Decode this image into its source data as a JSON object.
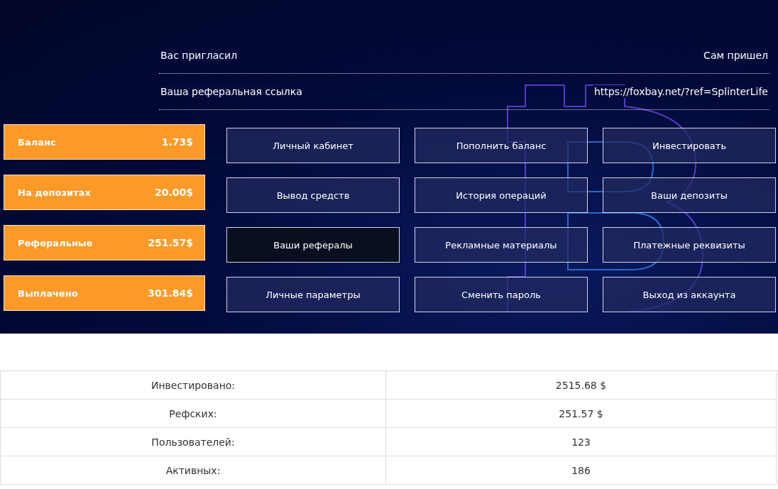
{
  "info_rows": [
    {
      "label": "Вас пригласил",
      "value": "Сам пришел"
    },
    {
      "label": "Ваша реферальная ссылка",
      "value": "https://foxbay.net/?ref=SplinterLife"
    }
  ],
  "stats": [
    {
      "label": "Баланс",
      "value": "1.73$"
    },
    {
      "label": "На депозитах",
      "value": "20.00$"
    },
    {
      "label": "Реферальные",
      "value": "251.57$"
    },
    {
      "label": "Выплачено",
      "value": "301.84$"
    }
  ],
  "menu": [
    {
      "label": "Личный кабинет",
      "selected": false
    },
    {
      "label": "Пополнить баланс",
      "selected": false
    },
    {
      "label": "Инвестировать",
      "selected": false
    },
    {
      "label": "Вывод средств",
      "selected": false
    },
    {
      "label": "История операций",
      "selected": false
    },
    {
      "label": "Ваши депозиты",
      "selected": false
    },
    {
      "label": "Ваши рефералы",
      "selected": true
    },
    {
      "label": "Рекламные материалы",
      "selected": false
    },
    {
      "label": "Платежные реквизиты",
      "selected": false
    },
    {
      "label": "Личные параметры",
      "selected": false
    },
    {
      "label": "Сменить пароль",
      "selected": false
    },
    {
      "label": "Выход из аккаунта",
      "selected": false
    }
  ],
  "summary": [
    {
      "label": "Инвестировано:",
      "value": "2515.68 $"
    },
    {
      "label": "Рефских:",
      "value": "251.57 $"
    },
    {
      "label": "Пользователей:",
      "value": "123"
    },
    {
      "label": "Активных:",
      "value": "186"
    }
  ]
}
